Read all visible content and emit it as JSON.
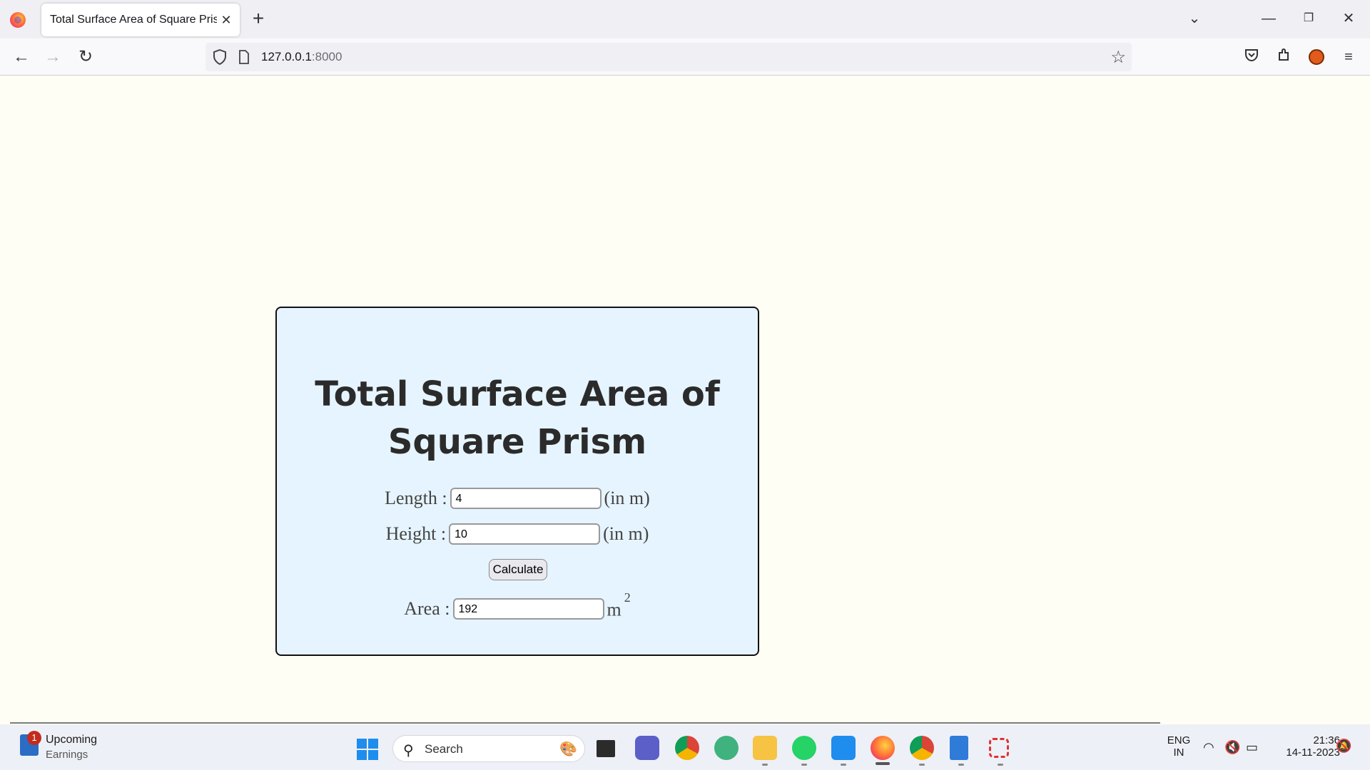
{
  "browser": {
    "tab_title": "Total Surface Area of Square Prism",
    "tab_close": "✕",
    "new_tab": "+",
    "url_host": "127.0.0.1",
    "url_port": ":8000"
  },
  "page": {
    "title": "Total Surface Area of Square Prism",
    "length_label": "Length :",
    "length_value": "4",
    "length_unit": "(in m)",
    "height_label": "Height :",
    "height_value": "10",
    "height_unit": "(in m)",
    "calculate_label": "Calculate",
    "area_label": "Area :",
    "area_value": "192",
    "area_unit": "m",
    "area_unit_exp": "2"
  },
  "taskbar": {
    "widget_badge": "1",
    "widget_title": "Upcoming",
    "widget_subtitle": "Earnings",
    "search_label": "Search",
    "lang_top": "ENG",
    "lang_bottom": "IN",
    "time": "21:36",
    "date": "14-11-2023"
  },
  "colors": {
    "page_bg": "#fffef5",
    "card_bg": "#e6f4ff",
    "card_border": "#111111",
    "title_text": "#2b2b2b"
  }
}
